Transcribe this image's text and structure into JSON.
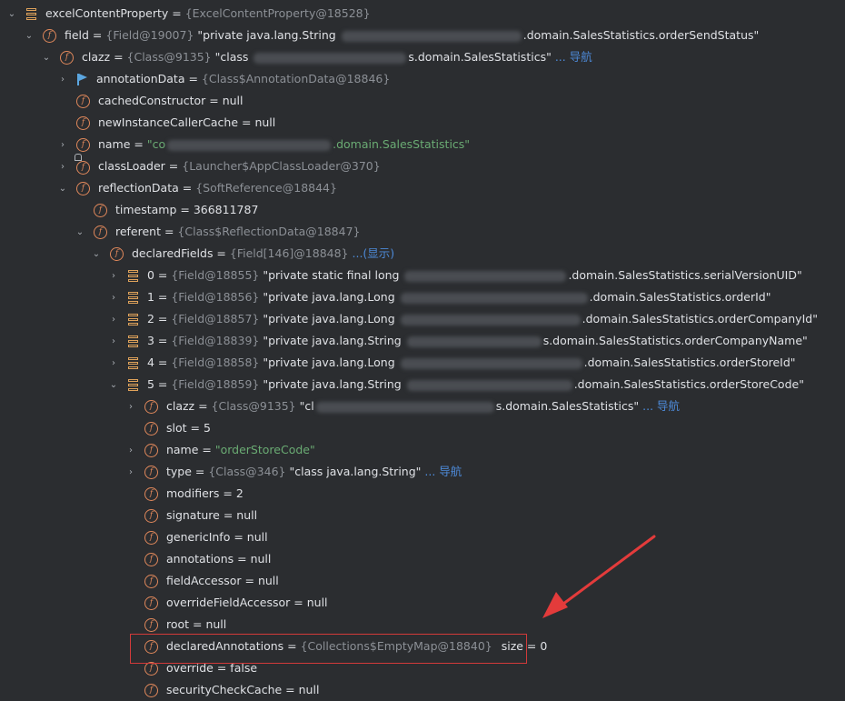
{
  "root": {
    "name": "excelContentProperty",
    "type": "{ExcelContentProperty@18528}"
  },
  "field": {
    "name": "field",
    "type": "{Field@19007}",
    "value_a": "\"private java.lang.String ",
    "value_b": ".domain.SalesStatistics.orderSendStatus\""
  },
  "clazz": {
    "name": "clazz",
    "type": "{Class@9135}",
    "value_a": "\"class ",
    "value_b": "s.domain.SalesStatistics\"",
    "nav": "... 导航"
  },
  "annotationData": {
    "name": "annotationData",
    "type": "{Class$AnnotationData@18846}"
  },
  "cachedConstructor": {
    "name": "cachedConstructor",
    "value": "null"
  },
  "newInstanceCallerCache": {
    "name": "newInstanceCallerCache",
    "value": "null"
  },
  "nameField": {
    "name": "name",
    "value_a": "\"co",
    "value_b": ".domain.SalesStatistics\""
  },
  "classLoader": {
    "name": "classLoader",
    "type": "{Launcher$AppClassLoader@370}"
  },
  "reflectionData": {
    "name": "reflectionData",
    "type": "{SoftReference@18844}"
  },
  "timestamp": {
    "name": "timestamp",
    "value": "366811787"
  },
  "referent": {
    "name": "referent",
    "type": "{Class$ReflectionData@18847}"
  },
  "declaredFields": {
    "name": "declaredFields",
    "type": "{Field[146]@18848}",
    "nav": "...(显示)"
  },
  "fields": [
    {
      "index": "0",
      "type": "{Field@18855}",
      "value_a": "\"private static final long ",
      "value_b": ".domain.SalesStatistics.serialVersionUID\""
    },
    {
      "index": "1",
      "type": "{Field@18856}",
      "value_a": "\"private java.lang.Long ",
      "value_b": ".domain.SalesStatistics.orderId\""
    },
    {
      "index": "2",
      "type": "{Field@18857}",
      "value_a": "\"private java.lang.Long ",
      "value_b": ".domain.SalesStatistics.orderCompanyId\""
    },
    {
      "index": "3",
      "type": "{Field@18839}",
      "value_a": "\"private java.lang.String ",
      "value_b": "s.domain.SalesStatistics.orderCompanyName\""
    },
    {
      "index": "4",
      "type": "{Field@18858}",
      "value_a": "\"private java.lang.Long ",
      "value_b": ".domain.SalesStatistics.orderStoreId\""
    },
    {
      "index": "5",
      "type": "{Field@18859}",
      "value_a": "\"private java.lang.String ",
      "value_b": ".domain.SalesStatistics.orderStoreCode\""
    }
  ],
  "f5": {
    "clazz": {
      "name": "clazz",
      "type": "{Class@9135}",
      "value_a": "\"cl",
      "value_b": "s.domain.SalesStatistics\"",
      "nav": "... 导航"
    },
    "slot": {
      "name": "slot",
      "value": "5"
    },
    "name": {
      "name": "name",
      "value": "\"orderStoreCode\""
    },
    "type": {
      "name": "type",
      "type": "{Class@346}",
      "value": "\"class java.lang.String\"",
      "nav": "... 导航"
    },
    "modifiers": {
      "name": "modifiers",
      "value": "2"
    },
    "signature": {
      "name": "signature",
      "value": "null"
    },
    "genericInfo": {
      "name": "genericInfo",
      "value": "null"
    },
    "annotations": {
      "name": "annotations",
      "value": "null"
    },
    "fieldAccessor": {
      "name": "fieldAccessor",
      "value": "null"
    },
    "overrideFieldAccessor": {
      "name": "overrideFieldAccessor",
      "value": "null"
    },
    "root": {
      "name": "root",
      "value": "null"
    },
    "declaredAnnotations": {
      "name": "declaredAnnotations",
      "type": "{Collections$EmptyMap@18840}",
      "size": "size = 0"
    },
    "override": {
      "name": "override",
      "value": "false"
    },
    "securityCheckCache": {
      "name": "securityCheckCache",
      "value": "null"
    }
  },
  "symbols": {
    "eq": " = ",
    "expanded": "⌄",
    "collapsed": "›",
    "field_letter": "f"
  },
  "colors": {
    "background": "#2b2d30",
    "text": "#dfe1e5",
    "type": "#8c9096",
    "string": "#6aab73",
    "link": "#4d8ad8",
    "field_icon": "#e0885b",
    "highlight_box": "#d23a3a",
    "arrow": "#e33b3b"
  }
}
